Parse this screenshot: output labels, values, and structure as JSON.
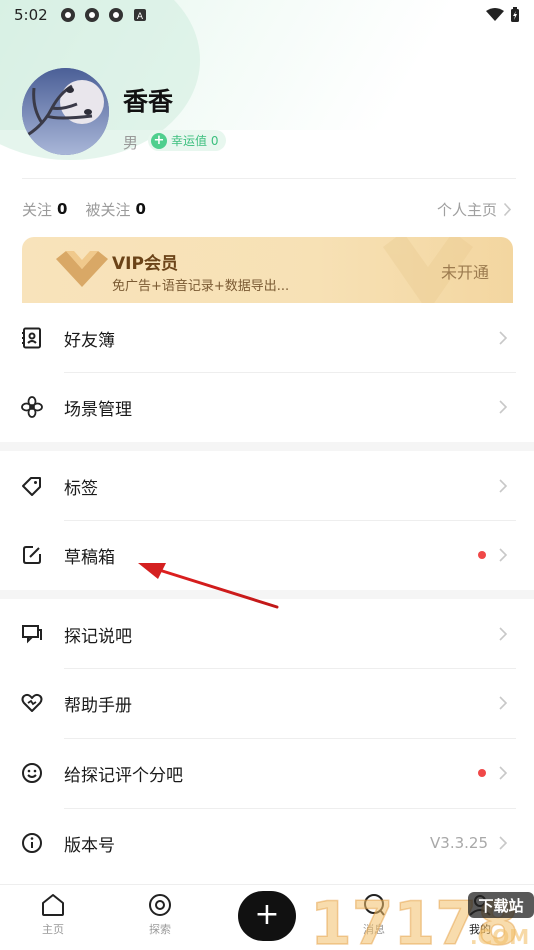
{
  "status_bar": {
    "time": "5:02"
  },
  "profile": {
    "name": "香香",
    "gender": "男",
    "luck_label": "幸运值 0"
  },
  "follow": {
    "following_label": "关注",
    "following_count": "0",
    "followers_label": "被关注",
    "followers_count": "0",
    "homepage_label": "个人主页"
  },
  "vip": {
    "title": "VIP会员",
    "subtitle": "免广告+语音记录+数据导出...",
    "status": "未开通"
  },
  "menu": {
    "friends": "好友簿",
    "scenes": "场景管理",
    "tags": "标签",
    "drafts": "草稿箱",
    "forum": "探记说吧",
    "help": "帮助手册",
    "rate": "给探记评个分吧",
    "version_label": "版本号",
    "version_value": "V3.3.25"
  },
  "bottom_nav": {
    "home": "主页",
    "explore": "探索",
    "add": "+",
    "messages": "消息",
    "mine": "我的"
  },
  "watermark": {
    "text": "17178",
    "sub": "下载站",
    "domain": ".COM"
  },
  "colors": {
    "accent_green": "#4fcf8e",
    "red_dot": "#f04848",
    "vip_gold": "#f7e1b5",
    "annotation_red": "#d42020"
  }
}
